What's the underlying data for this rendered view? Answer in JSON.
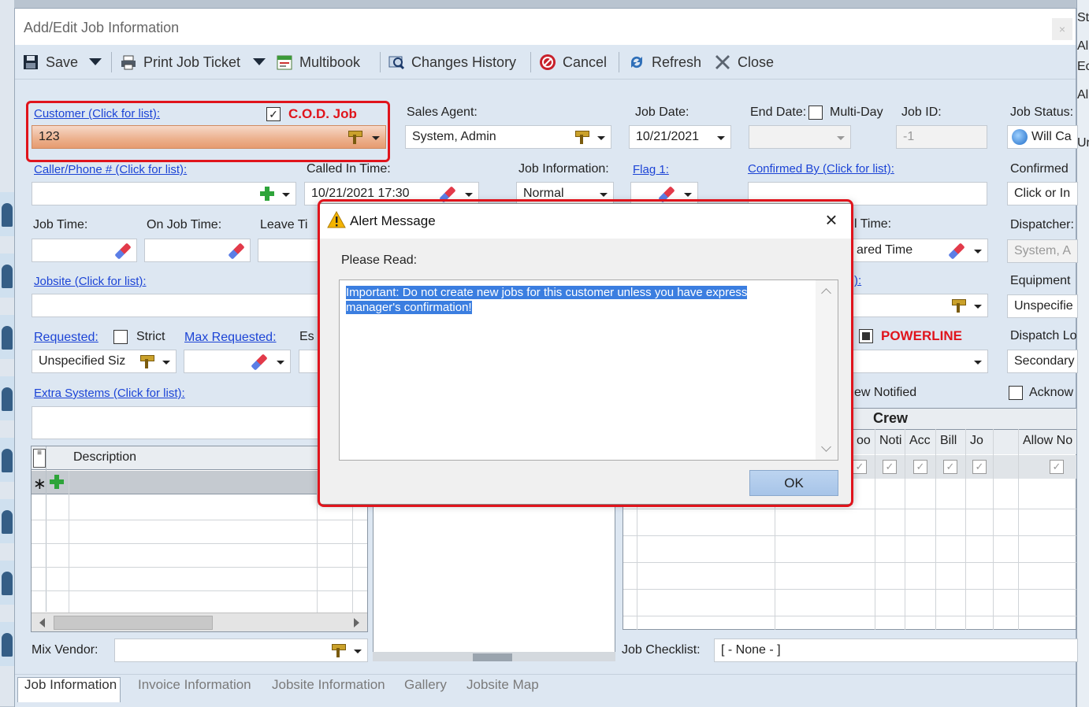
{
  "window": {
    "title": "Add/Edit Job Information"
  },
  "toolbar": {
    "save": "Save",
    "print_job_ticket": "Print Job Ticket",
    "multibook": "Multibook",
    "changes_history": "Changes History",
    "cancel": "Cancel",
    "refresh": "Refresh",
    "close": "Close"
  },
  "form": {
    "customer_link": "Customer (Click for list):",
    "cod_label": "C.O.D. Job",
    "customer_value": "123",
    "sales_agent_label": "Sales Agent:",
    "sales_agent_value": "System, Admin",
    "job_date_label": "Job Date:",
    "job_date_value": "10/21/2021",
    "end_date_label": "End Date:",
    "multi_day_label": "Multi-Day",
    "job_id_label": "Job ID:",
    "job_id_value": "-1",
    "job_status_label": "Job Status:",
    "job_status_value": "Will Ca",
    "caller_link": "Caller/Phone # (Click for list):",
    "called_in_label": "Called In Time:",
    "called_in_value": "10/21/2021 17:30",
    "job_info_label": "Job Information:",
    "job_info_value": "Normal",
    "flag1_link": "Flag 1:",
    "confirmed_by_link": "Confirmed By (Click for list):",
    "confirmed_label": "Confirmed",
    "confirmed_value": "Click or In",
    "job_time_label": "Job Time:",
    "on_job_time_label": "On Job Time:",
    "leave_time_label": "Leave Ti",
    "time_label_right": "l Time:",
    "time_value_right": "ared Time",
    "dispatcher_label": "Dispatcher:",
    "dispatcher_value": "System, A",
    "jobsite_link": "Jobsite (Click for list):",
    "jobsite_partial_link": "):",
    "equipment_label": "Equipment",
    "equipment_value": "Unspecifie",
    "requested_link": "Requested:",
    "strict_label": "Strict",
    "max_requested_link": "Max Requested:",
    "est_label": "Es",
    "requested_value": "Unspecified Siz",
    "powerline_label": "POWERLINE",
    "dispatch_loc_label": "Dispatch Lo",
    "dispatch_loc_value": "Secondary",
    "extra_systems_link": "Extra Systems (Click for list):",
    "crew_notified_label": "ew Notified",
    "acknow_label": "Acknow",
    "description_header": "Description",
    "crew_header": "Crew",
    "crew_cols": [
      "oo",
      "Noti",
      "Acc",
      "Bill",
      "Jo",
      "Allow No"
    ],
    "mix_vendor_label": "Mix Vendor:",
    "job_checklist_label": "Job Checklist:",
    "job_checklist_value": "[ - None - ]"
  },
  "right_edge": {
    "labels": [
      "St",
      "Al",
      "Ec",
      "Al",
      "Ur"
    ]
  },
  "tabs": [
    "Job Information",
    "Invoice Information",
    "Jobsite Information",
    "Gallery",
    "Jobsite Map"
  ],
  "alert": {
    "title": "Alert Message",
    "prompt": "Please Read:",
    "message": "Important: Do not create new jobs for this customer unless you have express manager's confirmation!",
    "ok": "OK"
  },
  "colors": {
    "highlight_red": "#e0141c",
    "link_blue": "#1c44d6",
    "selection_blue": "#3b7ee0"
  }
}
